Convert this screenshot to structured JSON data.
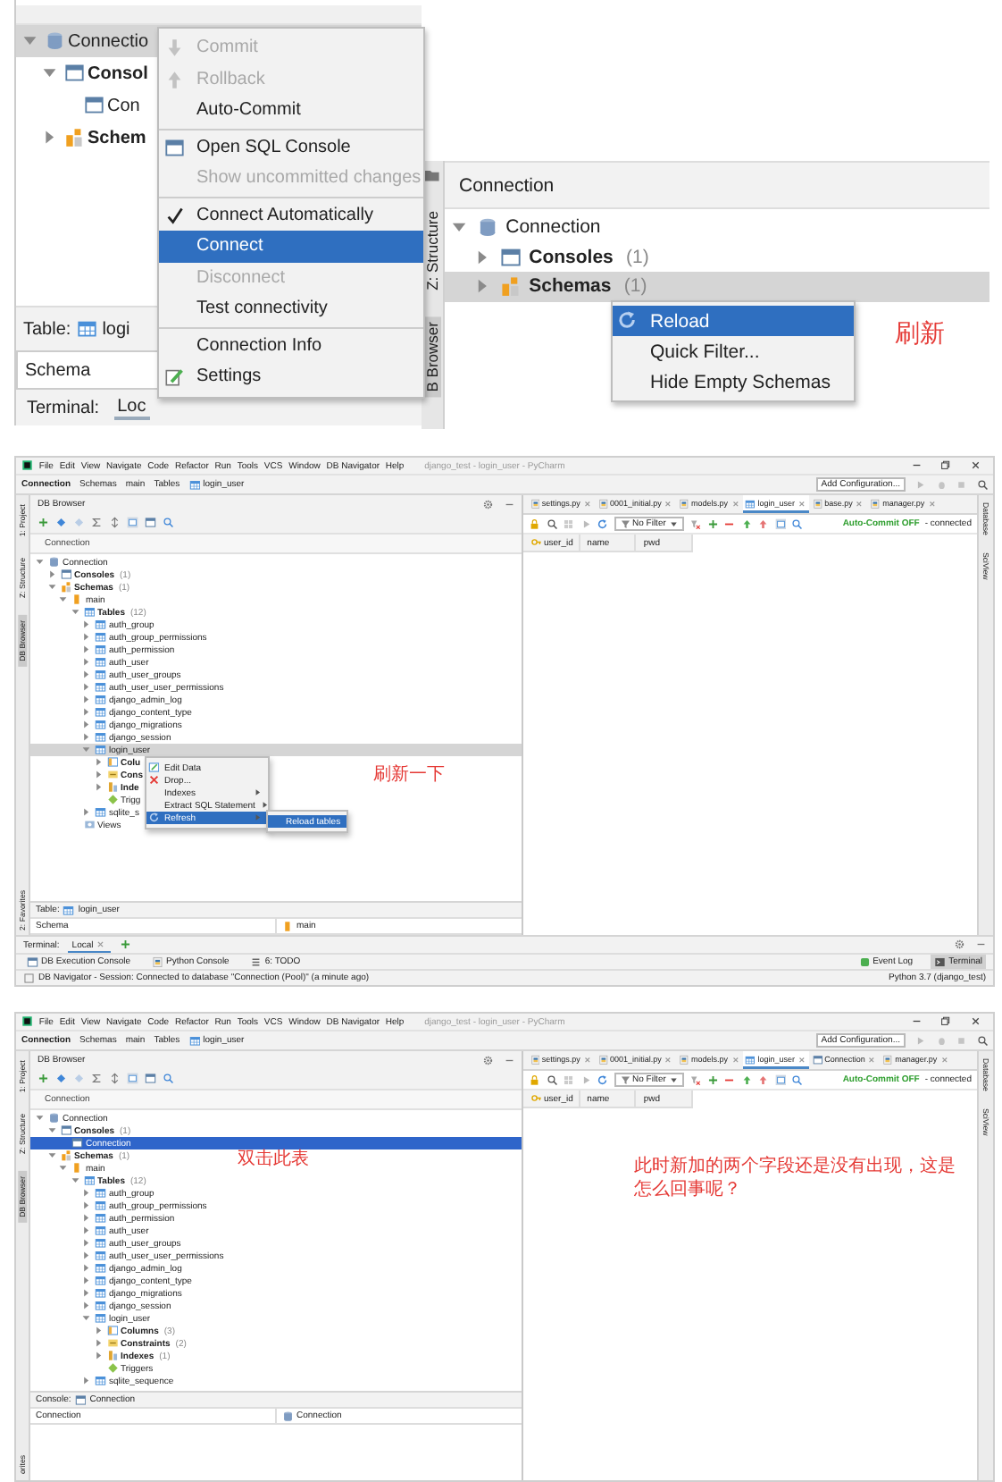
{
  "top_left": {
    "tree": [
      {
        "label": "Connectio",
        "kind": "connection",
        "expanded": true,
        "selected": true,
        "children": [
          {
            "label": "Consol",
            "kind": "consoles",
            "expanded": true,
            "selected": false,
            "children": [
              {
                "label": "Con",
                "kind": "console",
                "selected": false
              }
            ]
          },
          {
            "label": "Schem",
            "kind": "schemas",
            "expanded": false,
            "selected": false
          }
        ]
      }
    ],
    "table_label": "Table:",
    "table_value": "logi",
    "schema_label": "Schema",
    "terminal_label": "Terminal:",
    "terminal_tab": "Loc",
    "menu": {
      "groups": [
        [
          {
            "label": "Commit",
            "kind": "commit",
            "disabled": true,
            "checked": false,
            "selected": false
          },
          {
            "label": "Rollback",
            "kind": "rollback",
            "disabled": true,
            "checked": false,
            "selected": false
          },
          {
            "label": "Auto-Commit",
            "kind": "plain",
            "disabled": false,
            "checked": false,
            "selected": false
          }
        ],
        [
          {
            "label": "Open SQL Console",
            "kind": "console",
            "disabled": false,
            "checked": false,
            "selected": false
          },
          {
            "label": "Show uncommitted changes",
            "kind": "plain",
            "disabled": true,
            "checked": false,
            "selected": false
          }
        ],
        [
          {
            "label": "Connect Automatically",
            "kind": "plain",
            "disabled": false,
            "checked": true,
            "selected": false
          },
          {
            "label": "Connect",
            "kind": "plain",
            "disabled": false,
            "checked": false,
            "selected": true
          },
          {
            "label": "Disconnect",
            "kind": "plain",
            "disabled": true,
            "checked": false,
            "selected": false
          },
          {
            "label": "Test connectivity",
            "kind": "plain",
            "disabled": false,
            "checked": false,
            "selected": false
          }
        ],
        [
          {
            "label": "Connection Info",
            "kind": "plain",
            "disabled": false,
            "checked": false,
            "selected": false
          },
          {
            "label": "Settings",
            "kind": "settings",
            "disabled": false,
            "checked": false,
            "selected": false
          }
        ]
      ]
    }
  },
  "top_right": {
    "stripe": [
      {
        "label": "Z: Structure",
        "selected": false
      },
      {
        "label": "B Browser",
        "selected": true
      }
    ],
    "header": "Connection",
    "tree": [
      {
        "label": "Connection",
        "kind": "connection",
        "expanded": true,
        "selected": false,
        "children": [
          {
            "label": "Consoles",
            "count": "(1)",
            "kind": "consoles",
            "expanded": false,
            "selected": false
          },
          {
            "label": "Schemas",
            "count": "(1)",
            "kind": "schemas",
            "expanded": false,
            "selected": true
          }
        ]
      }
    ],
    "menu": {
      "groups": [
        [
          {
            "label": "Reload",
            "kind": "reload",
            "selected": true
          },
          {
            "label": "Quick Filter...",
            "kind": "plain",
            "selected": false
          },
          {
            "label": "Hide Empty Schemas",
            "kind": "plain",
            "selected": false
          }
        ]
      ]
    },
    "note": "刷新"
  },
  "ide_views": [
    {
      "menus": [
        "File",
        "Edit",
        "View",
        "Navigate",
        "Code",
        "Refactor",
        "Run",
        "Tools",
        "VCS",
        "Window",
        "DB Navigator",
        "Help"
      ],
      "title": "django_test - login_user - PyCharm",
      "breadcrumb": [
        {
          "label": "Connection",
          "kind": "root"
        },
        {
          "label": "Schemas",
          "kind": "plain"
        },
        {
          "label": "main",
          "kind": "plain"
        },
        {
          "label": "Tables",
          "kind": "plain"
        },
        {
          "label": "login_user",
          "kind": "table"
        }
      ],
      "run_config": "Add Configuration...",
      "left_stripe": [
        {
          "label": "1: Project",
          "selected": false
        },
        {
          "label": "Z: Structure",
          "selected": false
        },
        {
          "label": "DB Browser",
          "selected": true
        }
      ],
      "stripe_bottom": "2: Favorites",
      "browser_title": "DB Browser",
      "tree_header": "Connection",
      "tree_focused": false,
      "tree": [
        {
          "label": "Connection",
          "kind": "connection",
          "expanded": true,
          "selected": false,
          "children": [
            {
              "label": "Consoles",
              "count": "(1)",
              "kind": "consoles",
              "expanded": false,
              "selected": false
            },
            {
              "label": "Schemas",
              "count": "(1)",
              "kind": "schemas",
              "expanded": true,
              "selected": false,
              "children": [
                {
                  "label": "main",
                  "kind": "schema",
                  "expanded": true,
                  "selected": false,
                  "children": [
                    {
                      "label": "Tables",
                      "count": "(12)",
                      "kind": "tables",
                      "expanded": true,
                      "selected": false,
                      "children": [
                        {
                          "label": "auth_group",
                          "kind": "table",
                          "expanded": false,
                          "selected": false
                        },
                        {
                          "label": "auth_group_permissions",
                          "kind": "table",
                          "expanded": false,
                          "selected": false
                        },
                        {
                          "label": "auth_permission",
                          "kind": "table",
                          "expanded": false,
                          "selected": false
                        },
                        {
                          "label": "auth_user",
                          "kind": "table",
                          "expanded": false,
                          "selected": false
                        },
                        {
                          "label": "auth_user_groups",
                          "kind": "table",
                          "expanded": false,
                          "selected": false
                        },
                        {
                          "label": "auth_user_user_permissions",
                          "kind": "table",
                          "expanded": false,
                          "selected": false
                        },
                        {
                          "label": "django_admin_log",
                          "kind": "table",
                          "expanded": false,
                          "selected": false
                        },
                        {
                          "label": "django_content_type",
                          "kind": "table",
                          "expanded": false,
                          "selected": false
                        },
                        {
                          "label": "django_migrations",
                          "kind": "table",
                          "expanded": false,
                          "selected": false
                        },
                        {
                          "label": "django_session",
                          "kind": "table",
                          "expanded": false,
                          "selected": false
                        },
                        {
                          "label": "login_user",
                          "kind": "table",
                          "expanded": true,
                          "selected": true,
                          "children": [
                            {
                              "label": "Colu",
                              "kind": "columns",
                              "expanded": false,
                              "selected": false
                            },
                            {
                              "label": "Cons",
                              "kind": "constraints",
                              "expanded": false,
                              "selected": false
                            },
                            {
                              "label": "Inde",
                              "kind": "indexes",
                              "expanded": false,
                              "selected": false
                            },
                            {
                              "label": "Trigg",
                              "kind": "triggers",
                              "selected": false
                            }
                          ]
                        },
                        {
                          "label": "sqlite_s",
                          "kind": "table",
                          "expanded": false,
                          "selected": false
                        }
                      ]
                    },
                    {
                      "label": "Views",
                      "kind": "views",
                      "selected": false
                    }
                  ]
                }
              ]
            }
          ]
        }
      ],
      "context_menu": {
        "groups": [
          [
            {
              "label": "Edit Data",
              "kind": "edit",
              "submenu": false,
              "selected": false
            },
            {
              "label": "Drop...",
              "kind": "drop",
              "submenu": false,
              "selected": false
            },
            {
              "label": "Indexes",
              "kind": "plain",
              "submenu": true,
              "selected": false
            },
            {
              "label": "Extract SQL Statement",
              "kind": "plain",
              "submenu": true,
              "selected": false
            },
            {
              "label": "Refresh",
              "kind": "reload",
              "submenu": true,
              "selected": true
            }
          ]
        ],
        "submenu": {
          "groups": [
            [
              {
                "label": "Reload tables",
                "selected": true
              }
            ]
          ]
        }
      },
      "tree_note": "刷新一下",
      "properties": {
        "label": "Table:",
        "kind": "table",
        "value": "login_user",
        "rows": [
          {
            "name": "Schema",
            "kind": "schema",
            "value": "main"
          }
        ]
      },
      "editor_tabs": [
        {
          "label": "settings.py",
          "kind": "python",
          "selected": false
        },
        {
          "label": "0001_initial.py",
          "kind": "python",
          "selected": false
        },
        {
          "label": "models.py",
          "kind": "python",
          "selected": false
        },
        {
          "label": "login_user",
          "kind": "table",
          "selected": true
        },
        {
          "label": "base.py",
          "kind": "python",
          "selected": false
        },
        {
          "label": "manager.py",
          "kind": "python",
          "selected": false
        }
      ],
      "filter": "No Filter",
      "auto_commit": "Auto-Commit OFF",
      "connection_state": "- connected",
      "columns": [
        {
          "label": "user_id",
          "kind": "key"
        },
        {
          "label": "name",
          "kind": "plain"
        },
        {
          "label": "pwd",
          "kind": "plain"
        }
      ],
      "right_stripe": [
        "Database",
        "SciView"
      ],
      "terminal": {
        "label": "Terminal:",
        "tabs": [
          {
            "label": "Local",
            "selected": true
          }
        ]
      },
      "tool_windows_left": [
        {
          "label": "DB Execution Console",
          "kind": "console",
          "selected": false
        },
        {
          "label": "Python Console",
          "kind": "python",
          "selected": false
        },
        {
          "label": "6: TODO",
          "kind": "todo",
          "selected": false
        }
      ],
      "tool_windows_right": [
        {
          "label": "Event Log",
          "kind": "log",
          "selected": false
        },
        {
          "label": "Terminal",
          "kind": "terminal",
          "selected": true
        }
      ],
      "status": {
        "text": "DB Navigator - Session: Connected to database \"Connection (Pool)\" (a minute ago)",
        "right": "Python 3.7 (django_test)"
      }
    },
    {
      "menus": [
        "File",
        "Edit",
        "View",
        "Navigate",
        "Code",
        "Refactor",
        "Run",
        "Tools",
        "VCS",
        "Window",
        "DB Navigator",
        "Help"
      ],
      "title": "django_test - login_user - PyCharm",
      "breadcrumb": [
        {
          "label": "Connection",
          "kind": "root"
        },
        {
          "label": "Schemas",
          "kind": "plain"
        },
        {
          "label": "main",
          "kind": "plain"
        },
        {
          "label": "Tables",
          "kind": "plain"
        },
        {
          "label": "login_user",
          "kind": "table"
        }
      ],
      "run_config": "Add Configuration...",
      "left_stripe": [
        {
          "label": "1: Project",
          "selected": false
        },
        {
          "label": "Z: Structure",
          "selected": false
        },
        {
          "label": "DB Browser",
          "selected": true
        }
      ],
      "stripe_bottom": "orites",
      "browser_title": "DB Browser",
      "tree_header": "Connection",
      "tree_focused": true,
      "tree": [
        {
          "label": "Connection",
          "kind": "connection",
          "expanded": true,
          "selected": false,
          "children": [
            {
              "label": "Consoles",
              "count": "(1)",
              "kind": "consoles",
              "expanded": true,
              "selected": false,
              "children": [
                {
                  "label": "Connection",
                  "kind": "console",
                  "selected": true
                }
              ]
            },
            {
              "label": "Schemas",
              "count": "(1)",
              "kind": "schemas",
              "expanded": true,
              "selected": false,
              "children": [
                {
                  "label": "main",
                  "kind": "schema",
                  "expanded": true,
                  "selected": false,
                  "children": [
                    {
                      "label": "Tables",
                      "count": "(12)",
                      "kind": "tables",
                      "expanded": true,
                      "selected": false,
                      "children": [
                        {
                          "label": "auth_group",
                          "kind": "table",
                          "expanded": false,
                          "selected": false
                        },
                        {
                          "label": "auth_group_permissions",
                          "kind": "table",
                          "expanded": false,
                          "selected": false
                        },
                        {
                          "label": "auth_permission",
                          "kind": "table",
                          "expanded": false,
                          "selected": false
                        },
                        {
                          "label": "auth_user",
                          "kind": "table",
                          "expanded": false,
                          "selected": false
                        },
                        {
                          "label": "auth_user_groups",
                          "kind": "table",
                          "expanded": false,
                          "selected": false
                        },
                        {
                          "label": "auth_user_user_permissions",
                          "kind": "table",
                          "expanded": false,
                          "selected": false
                        },
                        {
                          "label": "django_admin_log",
                          "kind": "table",
                          "expanded": false,
                          "selected": false
                        },
                        {
                          "label": "django_content_type",
                          "kind": "table",
                          "expanded": false,
                          "selected": false
                        },
                        {
                          "label": "django_migrations",
                          "kind": "table",
                          "expanded": false,
                          "selected": false
                        },
                        {
                          "label": "django_session",
                          "kind": "table",
                          "expanded": false,
                          "selected": false
                        },
                        {
                          "label": "login_user",
                          "kind": "table",
                          "expanded": true,
                          "selected": false,
                          "children": [
                            {
                              "label": "Columns",
                              "count": "(3)",
                              "kind": "columns",
                              "expanded": false,
                              "selected": false
                            },
                            {
                              "label": "Constraints",
                              "count": "(2)",
                              "kind": "constraints",
                              "expanded": false,
                              "selected": false
                            },
                            {
                              "label": "Indexes",
                              "count": "(1)",
                              "kind": "indexes",
                              "expanded": false,
                              "selected": false
                            },
                            {
                              "label": "Triggers",
                              "kind": "triggers",
                              "selected": false
                            }
                          ]
                        },
                        {
                          "label": "sqlite_sequence",
                          "kind": "table",
                          "expanded": false,
                          "selected": false
                        }
                      ]
                    }
                  ]
                }
              ]
            }
          ]
        }
      ],
      "tree_note": "双击此表",
      "console": {
        "label": "Console:",
        "value": "Connection",
        "columns": [
          {
            "label": "Connection",
            "kind": "plain"
          },
          {
            "label": "Connection",
            "kind": "connection"
          }
        ]
      },
      "editor_tabs": [
        {
          "label": "settings.py",
          "kind": "python",
          "selected": false
        },
        {
          "label": "0001_initial.py",
          "kind": "python",
          "selected": false
        },
        {
          "label": "models.py",
          "kind": "python",
          "selected": false
        },
        {
          "label": "login_user",
          "kind": "table",
          "selected": true
        },
        {
          "label": "Connection",
          "kind": "console",
          "selected": false
        },
        {
          "label": "manager.py",
          "kind": "python",
          "selected": false
        }
      ],
      "filter": "No Filter",
      "auto_commit": "Auto-Commit OFF",
      "connection_state": "- connected",
      "columns": [
        {
          "label": "user_id",
          "kind": "key"
        },
        {
          "label": "name",
          "kind": "plain"
        },
        {
          "label": "pwd",
          "kind": "plain"
        }
      ],
      "editor_note": "此时新加的两个字段还是没有出现，这是怎么回事呢？",
      "right_stripe": [
        "Database",
        "SciView"
      ]
    }
  ]
}
